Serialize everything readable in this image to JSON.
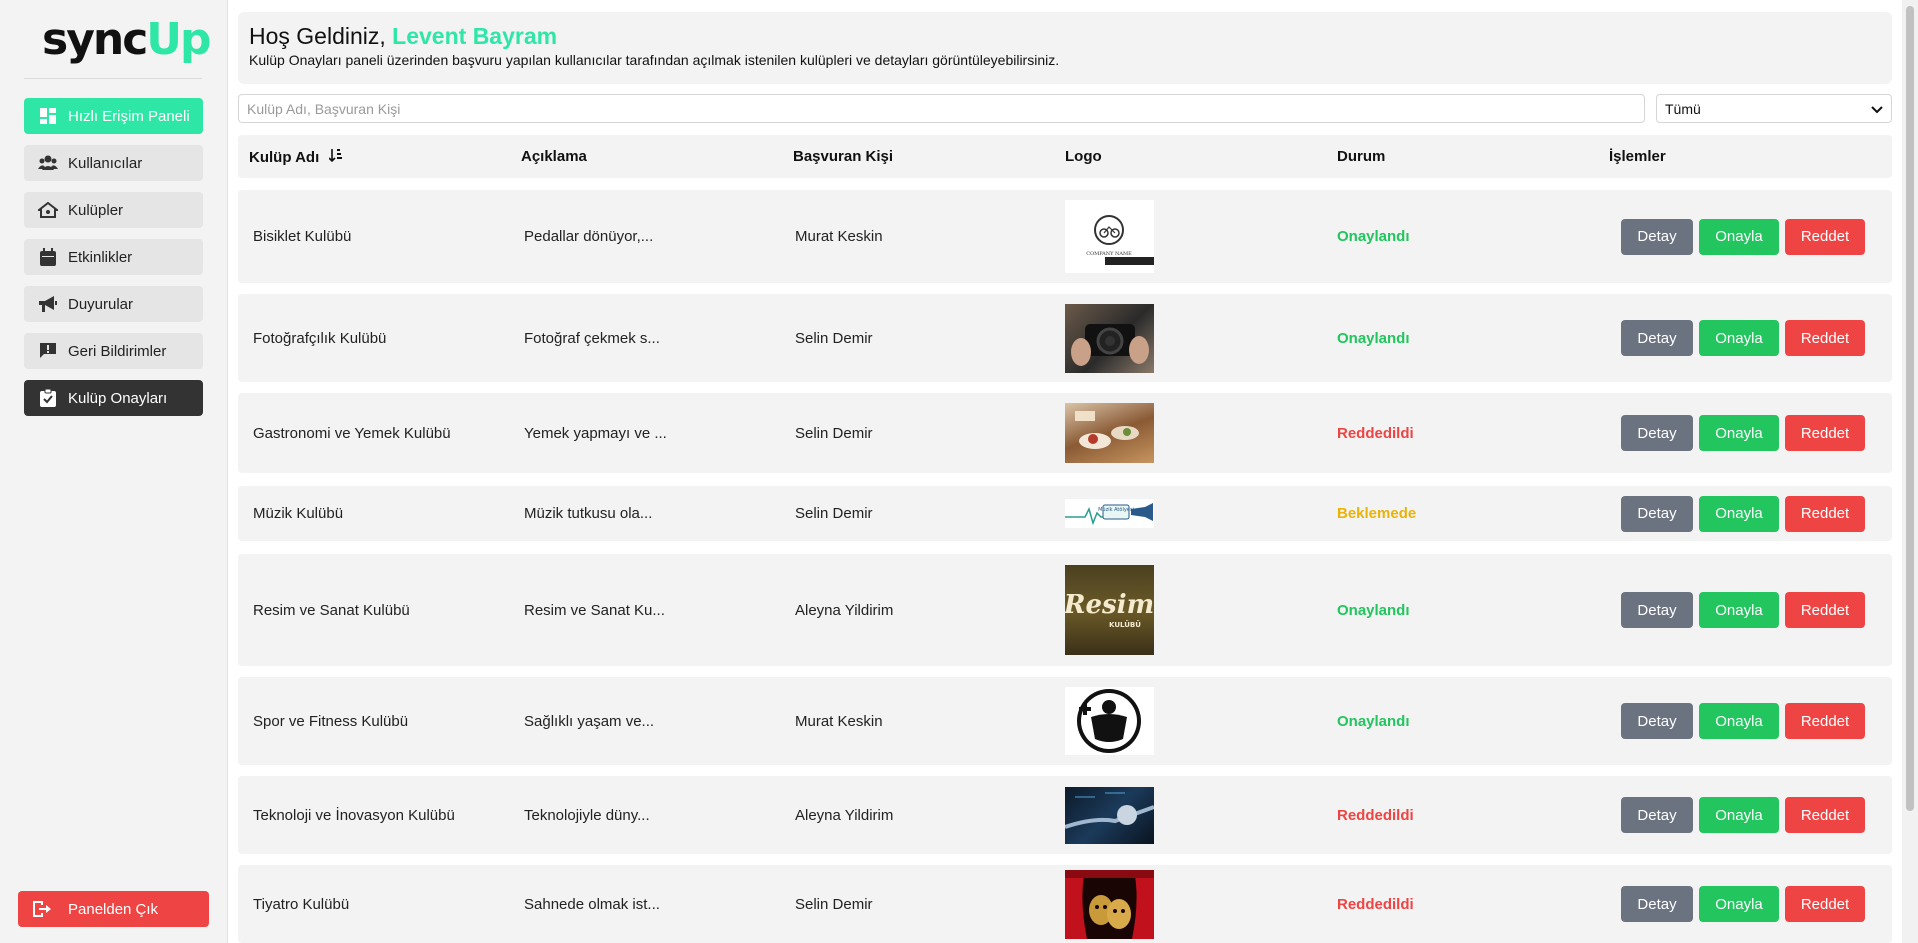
{
  "brand": {
    "sync": "sync",
    "up": "Up"
  },
  "sidebar": {
    "items": [
      {
        "label": "Hızlı Erişim Paneli",
        "icon": "dashboard-icon",
        "variant": "quick"
      },
      {
        "label": "Kullanıcılar",
        "icon": "users-icon",
        "variant": "default"
      },
      {
        "label": "Kulüpler",
        "icon": "clubs-icon",
        "variant": "default"
      },
      {
        "label": "Etkinlikler",
        "icon": "calendar-icon",
        "variant": "default"
      },
      {
        "label": "Duyurular",
        "icon": "megaphone-icon",
        "variant": "default"
      },
      {
        "label": "Geri Bildirimler",
        "icon": "feedback-icon",
        "variant": "default"
      },
      {
        "label": "Kulüp Onayları",
        "icon": "clipboard-check-icon",
        "variant": "active"
      }
    ],
    "logout_label": "Panelden Çık"
  },
  "header": {
    "greeting": "Hoş Geldiniz,",
    "user_name": "Levent Bayram",
    "description": "Kulüp Onayları paneli üzerinden başvuru yapılan kullanıcılar tarafından açılmak istenilen kulüpleri ve detayları görüntüleyebilirsiniz."
  },
  "search": {
    "placeholder": "Kulüp Adı, Başvuran Kişi",
    "value": ""
  },
  "filter": {
    "selected": "Tümü"
  },
  "table": {
    "columns": [
      "Kulüp Adı",
      "Açıklama",
      "Başvuran Kişi",
      "Logo",
      "Durum",
      "İşlemler"
    ],
    "actions": {
      "detail": "Detay",
      "approve": "Onayla",
      "reject": "Reddet"
    },
    "rows": [
      {
        "name": "Bisiklet Kulübü",
        "description": "Pedallar dönüyor,...",
        "applicant": "Murat Keskin",
        "status": "Onaylandı",
        "status_type": "ok",
        "logo": "bicycle-logo"
      },
      {
        "name": "Fotoğrafçılık Kulübü",
        "description": "Fotoğraf çekmek s...",
        "applicant": "Selin Demir",
        "status": "Onaylandı",
        "status_type": "ok",
        "logo": "camera-photo"
      },
      {
        "name": "Gastronomi ve Yemek Kulübü",
        "description": "Yemek yapmayı ve ...",
        "applicant": "Selin Demir",
        "status": "Reddedildi",
        "status_type": "rej",
        "logo": "food-photo"
      },
      {
        "name": "Müzik Kulübü",
        "description": "Müzik tutkusu ola...",
        "applicant": "Selin Demir",
        "status": "Beklemede",
        "status_type": "wait",
        "logo": "music-logo"
      },
      {
        "name": "Resim ve Sanat Kulübü",
        "description": "Resim ve Sanat Ku...",
        "applicant": "Aleyna Yildirim",
        "status": "Onaylandı",
        "status_type": "ok",
        "logo": "art-logo"
      },
      {
        "name": "Spor ve Fitness Kulübü",
        "description": "Sağlıklı yaşam ve...",
        "applicant": "Murat Keskin",
        "status": "Onaylandı",
        "status_type": "ok",
        "logo": "fitness-logo"
      },
      {
        "name": "Teknoloji ve İnovasyon Kulübü",
        "description": "Teknolojiyle düny...",
        "applicant": "Aleyna Yildirim",
        "status": "Reddedildi",
        "status_type": "rej",
        "logo": "tech-photo"
      },
      {
        "name": "Tiyatro Kulübü",
        "description": "Sahnede olmak ist...",
        "applicant": "Selin Demir",
        "status": "Reddedildi",
        "status_type": "rej",
        "logo": "theatre-masks"
      }
    ]
  },
  "colors": {
    "accent": "#2ee6a6",
    "approved": "#22c55e",
    "rejected": "#ef4444",
    "pending": "#eab308",
    "active_nav": "#333333"
  },
  "logo_texts": {
    "bicycle-logo": "COMPANY NAME",
    "music-logo": "Müzik Atölyesi",
    "art-logo": "Resim",
    "art-logo-sub": "KULÜBÜ"
  }
}
